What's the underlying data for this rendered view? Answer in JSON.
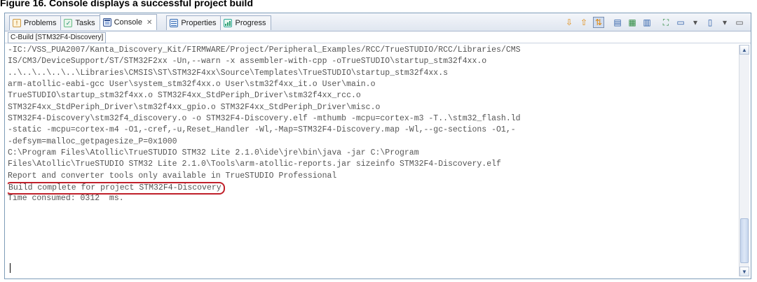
{
  "figure_caption": "Figure 16. Console displays a successful project build",
  "tabs": [
    {
      "label": "Problems",
      "icon": "problems-icon",
      "active": false
    },
    {
      "label": "Tasks",
      "icon": "tasks-icon",
      "active": false
    },
    {
      "label": "Console",
      "icon": "console-icon",
      "active": true,
      "close": "✕"
    },
    {
      "label": "Properties",
      "icon": "properties-icon",
      "active": false
    },
    {
      "label": "Progress",
      "icon": "progress-icon",
      "active": false
    }
  ],
  "toolbar_icons": [
    "terminate-icon",
    "remove-launch-icon",
    "scroll-lock-icon",
    "clear-console-icon",
    "pin-console-icon",
    "word-wrap-icon",
    "display-console-icon",
    "display-selected-icon",
    "open-console-icon",
    "view-menu-icon",
    "minimize-icon",
    "maximize-icon"
  ],
  "console_title": "C-Build [STM32F4-Discovery]",
  "console_lines": [
    "-IC:/VSS_PUA2007/Kanta_Discovery_Kit/FIRMWARE/Project/Peripheral_Examples/RCC/TrueSTUDIO/RCC/Libraries/CMS",
    "IS/CM3/DeviceSupport/ST/STM32F2xx -Un,--warn -x assembler-with-cpp -oTrueSTUDIO\\startup_stm32f4xx.o",
    "..\\..\\..\\..\\..\\Libraries\\CMSIS\\ST\\STM32F4xx\\Source\\Templates\\TrueSTUDIO\\startup_stm32f4xx.s",
    "arm-atollic-eabi-gcc User\\system_stm32f4xx.o User\\stm32f4xx_it.o User\\main.o",
    "TrueSTUDIO\\startup_stm32f4xx.o STM32F4xx_StdPeriph_Driver\\stm32f4xx_rcc.o",
    "STM32F4xx_StdPeriph_Driver\\stm32f4xx_gpio.o STM32F4xx_StdPeriph_Driver\\misc.o",
    "STM32F4-Discovery\\stm32f4_discovery.o -o STM32F4-Discovery.elf -mthumb -mcpu=cortex-m3 -T..\\stm32_flash.ld",
    "-static -mcpu=cortex-m4 -O1,-cref,-u,Reset_Handler -Wl,-Map=STM32F4-Discovery.map -Wl,--gc-sections -O1,-",
    "-defsym=malloc_getpagesize_P=0x1000",
    "C:\\Program Files\\Atollic\\TrueSTUDIO STM32 Lite 2.1.0\\ide\\jre\\bin\\java -jar C:\\Program",
    "Files\\Atollic\\TrueSTUDIO STM32 Lite 2.1.0\\Tools\\arm-atollic-reports.jar sizeinfo STM32F4-Discovery.elf",
    "Report and converter tools only available in TrueSTUDIO Professional",
    "Build complete for project STM32F4-Discovery",
    "Time consumed: 0312  ms."
  ],
  "highlight_line_index": 12,
  "colors": {
    "console_text": "#555555",
    "highlight_border": "#c0202a",
    "tab_border": "#9fb0c8"
  }
}
